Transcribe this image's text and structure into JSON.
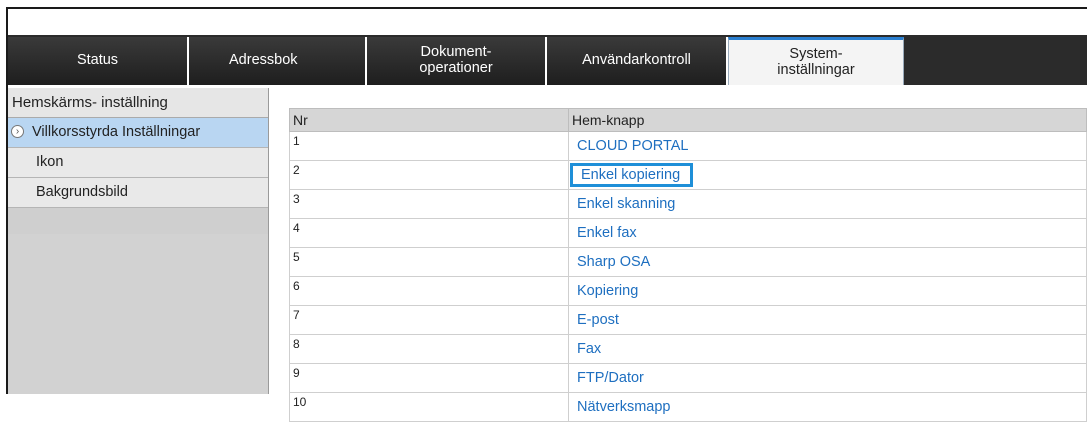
{
  "tabs": [
    {
      "label": "Status"
    },
    {
      "label": "Adressbok"
    },
    {
      "label": "Dokument-\noperationer"
    },
    {
      "label": "Användarkontroll"
    },
    {
      "label": "System-\ninställningar"
    }
  ],
  "sidebar": {
    "header": "Hemskärms- inställning",
    "items": [
      {
        "label": "Villkorsstyrda Inställningar"
      },
      {
        "label": "Ikon"
      },
      {
        "label": "Bakgrundsbild"
      }
    ]
  },
  "table": {
    "columns": [
      "Nr",
      "Hem-knapp"
    ],
    "rows": [
      {
        "nr": "1",
        "name": "CLOUD PORTAL"
      },
      {
        "nr": "2",
        "name": "Enkel kopiering"
      },
      {
        "nr": "3",
        "name": "Enkel skanning"
      },
      {
        "nr": "4",
        "name": "Enkel fax"
      },
      {
        "nr": "5",
        "name": "Sharp OSA"
      },
      {
        "nr": "6",
        "name": "Kopiering"
      },
      {
        "nr": "7",
        "name": "E-post"
      },
      {
        "nr": "8",
        "name": "Fax"
      },
      {
        "nr": "9",
        "name": "FTP/Dator"
      },
      {
        "nr": "10",
        "name": "Nätverksmapp"
      }
    ]
  },
  "colors": {
    "accent": "#1e8fd8",
    "link": "#1e6fc0",
    "selected_bg": "#b9d6f2"
  }
}
